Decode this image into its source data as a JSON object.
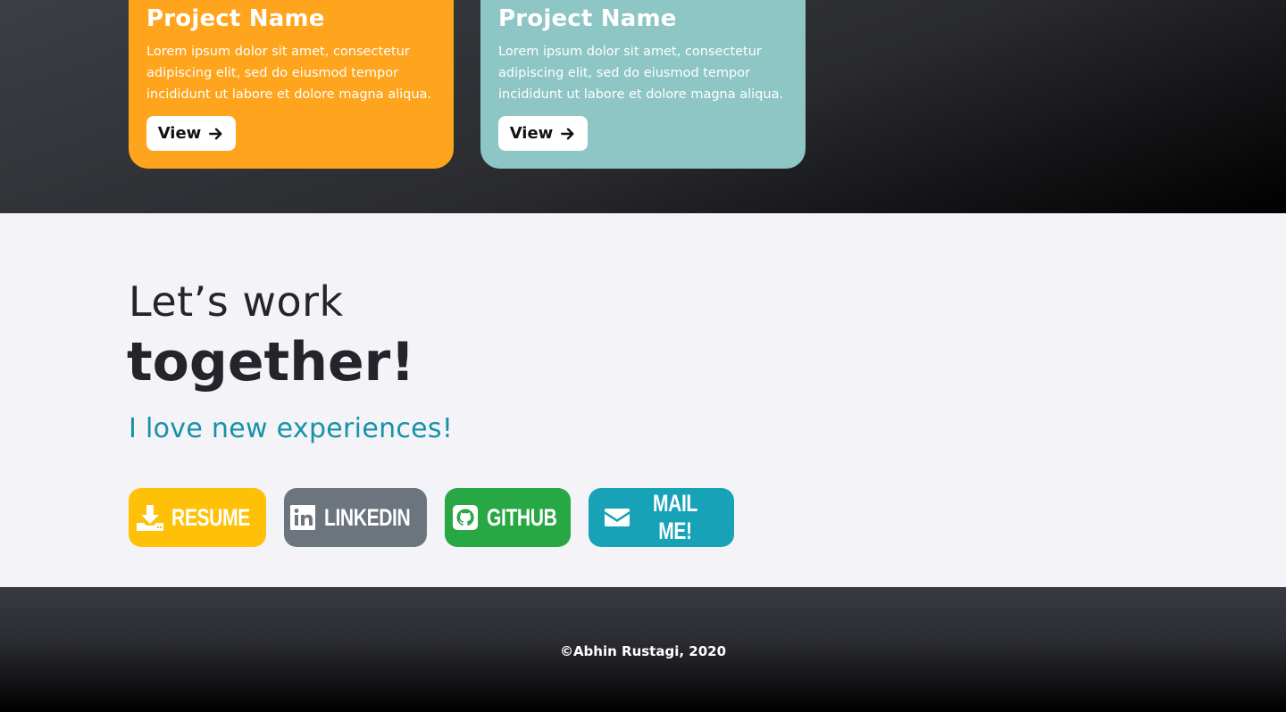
{
  "projects": [
    {
      "name": "Project Name",
      "description": "Lorem ipsum dolor sit amet, consectetur adipiscing elit, sed do eiusmod tempor incididunt ut labore et dolore magna aliqua.",
      "button_label": "View",
      "color": "#ffa41d"
    },
    {
      "name": "Project Name",
      "description": "Lorem ipsum dolor sit amet, consectetur adipiscing elit, sed do eiusmod tempor incididunt ut labore et dolore magna aliqua.",
      "button_label": "View",
      "color": "#8dc6c5"
    }
  ],
  "contact": {
    "headline_line1": "Let’s work",
    "headline_line2": "together!",
    "tagline": "I love new experiences!",
    "buttons": [
      {
        "label": "Resume",
        "icon": "download-icon",
        "color": "#ffc107"
      },
      {
        "label": "Linkedin",
        "icon": "linkedin-icon",
        "color": "#6c757d"
      },
      {
        "label": "Github",
        "icon": "github-icon",
        "color": "#28a745"
      },
      {
        "label": "Mail Me!",
        "icon": "envelope-icon",
        "color": "#17a2b8"
      }
    ]
  },
  "footer": {
    "copyright": "©Abhin Rustagi, 2020"
  }
}
